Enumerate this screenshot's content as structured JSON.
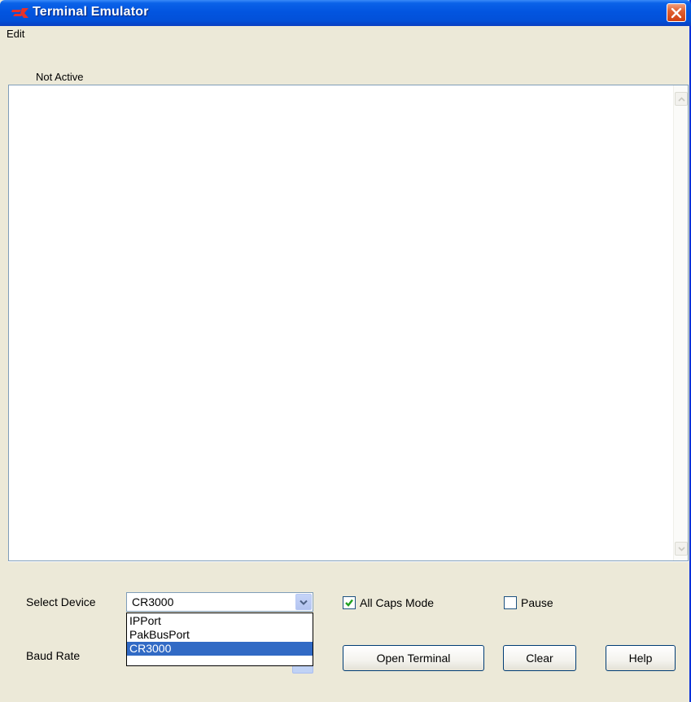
{
  "window": {
    "title": "Terminal Emulator"
  },
  "menu": {
    "edit": "Edit"
  },
  "status": {
    "text": "Not Active"
  },
  "controls": {
    "select_device_label": "Select Device",
    "select_device_value": "CR3000",
    "device_options": [
      "IPPort",
      "PakBusPort",
      "CR3000"
    ],
    "device_selected_index": 2,
    "baud_rate_label": "Baud Rate",
    "all_caps_label": "All Caps Mode",
    "all_caps_checked": true,
    "pause_label": "Pause",
    "pause_checked": false
  },
  "buttons": {
    "open_terminal": "Open Terminal",
    "clear": "Clear",
    "help": "Help"
  },
  "colors": {
    "titlebar": "#0255e0",
    "selection": "#316ac5",
    "close": "#e06030",
    "checkmark": "#21a121"
  }
}
